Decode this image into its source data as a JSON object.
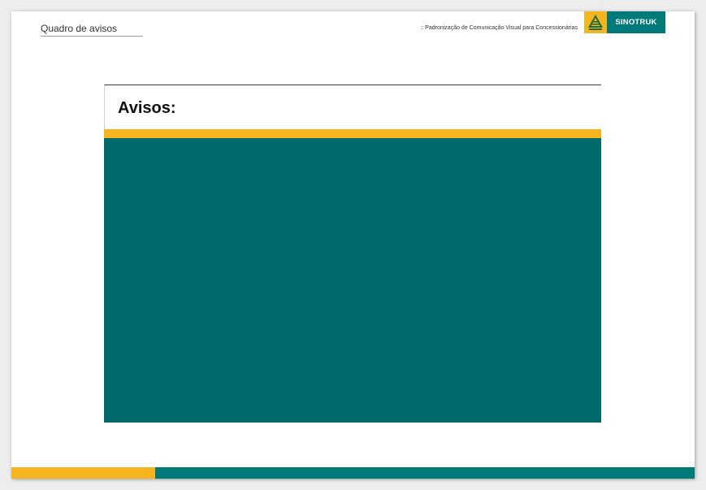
{
  "header": {
    "section_title": "Quadro de avisos",
    "document_subtitle": ":: Padronização de Comunicação Visual para Concessionárias"
  },
  "logo": {
    "brand": "SINOTRUK",
    "icon": "sinotruk-emblem-icon",
    "colors": {
      "mark": "#f6b51e",
      "text_bg": "#007a78"
    }
  },
  "board": {
    "title": "Avisos:",
    "colors": {
      "stripe": "#f6b51e",
      "body": "#00696b"
    }
  },
  "footer": {
    "colors": {
      "left": "#f6b51e",
      "right": "#007a78"
    }
  }
}
